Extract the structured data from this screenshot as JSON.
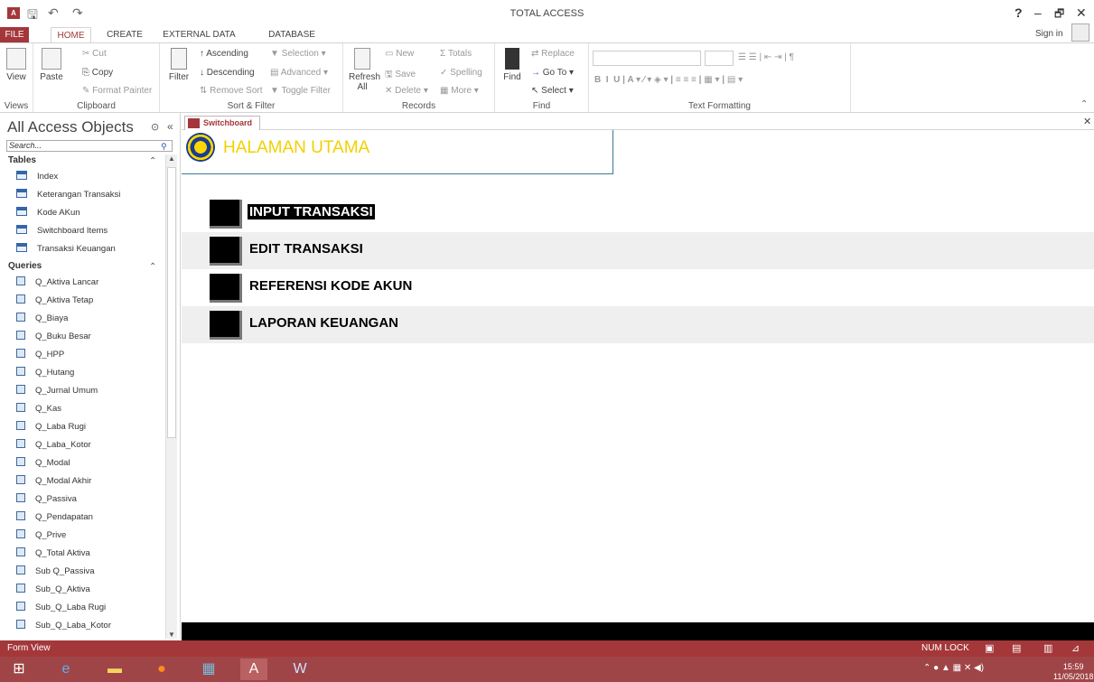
{
  "window": {
    "title": "TOTAL ACCESS",
    "help": "?",
    "minimize": "–",
    "restore": "🗗",
    "close": "✕",
    "sign_in": "Sign in"
  },
  "quick_access": {
    "save": "🖫",
    "undo": "↶",
    "redo": "↷"
  },
  "tabs": [
    "FILE",
    "HOME",
    "CREATE",
    "EXTERNAL DATA",
    "DATABASE TOOLS"
  ],
  "ribbon": {
    "views": {
      "view": "View",
      "label": "Views"
    },
    "clipboard": {
      "paste": "Paste",
      "cut": "Cut",
      "copy": "Copy",
      "format_painter": "Format Painter",
      "label": "Clipboard"
    },
    "sort_filter": {
      "filter": "Filter",
      "ascending": "Ascending",
      "descending": "Descending",
      "remove_sort": "Remove Sort",
      "selection": "Selection",
      "advanced": "Advanced",
      "toggle_filter": "Toggle Filter",
      "label": "Sort & Filter"
    },
    "records": {
      "refresh": "Refresh",
      "refresh_all": "All",
      "new": "New",
      "save": "Save",
      "delete": "Delete",
      "totals": "Totals",
      "spelling": "Spelling",
      "more": "More",
      "label": "Records"
    },
    "find": {
      "find": "Find",
      "replace": "Replace",
      "goto": "Go To",
      "select": "Select",
      "label": "Find"
    },
    "text_formatting": {
      "label": "Text Formatting"
    }
  },
  "nav": {
    "title": "All Access Objects",
    "search_placeholder": "Search...",
    "tables_label": "Tables",
    "tables": [
      "Index",
      "Keterangan Transaksi",
      "Kode AKun",
      "Switchboard Items",
      "Transaksi Keuangan"
    ],
    "queries_label": "Queries",
    "queries": [
      "Q_Aktiva Lancar",
      "Q_Aktiva Tetap",
      "Q_Biaya",
      "Q_Buku Besar",
      "Q_HPP",
      "Q_Hutang",
      "Q_Jurnal Umum",
      "Q_Kas",
      "Q_Laba Rugi",
      "Q_Laba_Kotor",
      "Q_Modal",
      "Q_Modal Akhir",
      "Q_Passiva",
      "Q_Pendapatan",
      "Q_Prive",
      "Q_Total Aktiva",
      "Sub Q_Passiva",
      "Sub_Q_Aktiva",
      "Sub_Q_Laba Rugi",
      "Sub_Q_Laba_Kotor"
    ]
  },
  "doc_tab": "Switchboard",
  "form": {
    "header_title": "HALAMAN UTAMA",
    "items": [
      "INPUT TRANSAKSI",
      "EDIT TRANSAKSI",
      "REFERENSI KODE AKUN",
      "LAPORAN KEUANGAN"
    ]
  },
  "status": {
    "view": "Form View",
    "num_lock": "NUM LOCK"
  },
  "clock": {
    "time": "15:59",
    "date": "11/05/2018"
  }
}
